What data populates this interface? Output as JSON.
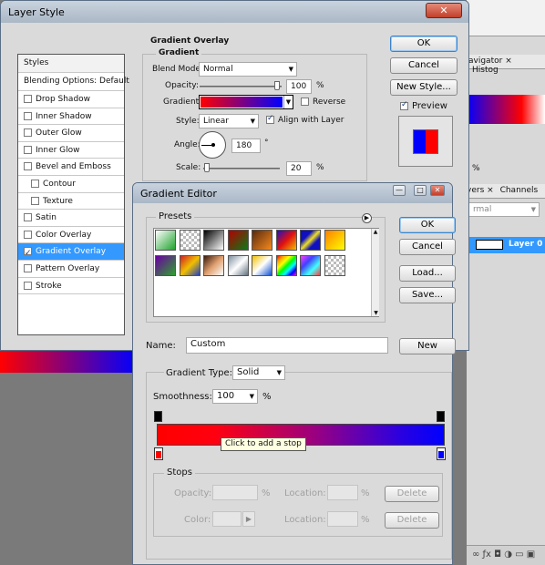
{
  "layer_style": {
    "title": "Layer Style",
    "styles_header": "Styles",
    "blending": "Blending Options: Default",
    "items": [
      {
        "label": "Drop Shadow",
        "checked": false,
        "sub": false
      },
      {
        "label": "Inner Shadow",
        "checked": false,
        "sub": false
      },
      {
        "label": "Outer Glow",
        "checked": false,
        "sub": false
      },
      {
        "label": "Inner Glow",
        "checked": false,
        "sub": false
      },
      {
        "label": "Bevel and Emboss",
        "checked": false,
        "sub": false
      },
      {
        "label": "Contour",
        "checked": false,
        "sub": true
      },
      {
        "label": "Texture",
        "checked": false,
        "sub": true
      },
      {
        "label": "Satin",
        "checked": false,
        "sub": false
      },
      {
        "label": "Color Overlay",
        "checked": false,
        "sub": false
      },
      {
        "label": "Gradient Overlay",
        "checked": true,
        "sub": false,
        "selected": true
      },
      {
        "label": "Pattern Overlay",
        "checked": false,
        "sub": false
      },
      {
        "label": "Stroke",
        "checked": false,
        "sub": false
      }
    ],
    "section_title": "Gradient Overlay",
    "subsection": "Gradient",
    "blend_mode_label": "Blend Mode:",
    "blend_mode": "Normal",
    "opacity_label": "Opacity:",
    "opacity": "100",
    "pct": "%",
    "gradient_label": "Gradient:",
    "reverse": "Reverse",
    "style_label": "Style:",
    "style": "Linear",
    "align": "Align with Layer",
    "angle_label": "Angle:",
    "angle": "180",
    "deg": "°",
    "scale_label": "Scale:",
    "scale": "20",
    "ok": "OK",
    "cancel": "Cancel",
    "new_style": "New Style...",
    "preview": "Preview"
  },
  "background": {
    "tabs": [
      "avigator",
      "Histog"
    ],
    "tabs2": [
      "yers",
      "Channels"
    ],
    "blend": "rmal",
    "layer": "Layer 0",
    "zoom": "%",
    "close": "×"
  },
  "gradient_editor": {
    "title": "Gradient Editor",
    "presets": "Presets",
    "ok": "OK",
    "cancel": "Cancel",
    "load": "Load...",
    "save": "Save...",
    "name_label": "Name:",
    "name": "Custom",
    "new": "New",
    "type_label": "Gradient Type:",
    "type": "Solid",
    "smooth_label": "Smoothness:",
    "smooth": "100",
    "pct": "%",
    "tooltip": "Click to add a stop",
    "stops": "Stops",
    "opacity_label": "Opacity:",
    "color_label": "Color:",
    "location_label": "Location:",
    "delete": "Delete"
  },
  "colors": {
    "red": "#ff0000",
    "blue": "#0000ff",
    "accent": "#3399ff"
  }
}
